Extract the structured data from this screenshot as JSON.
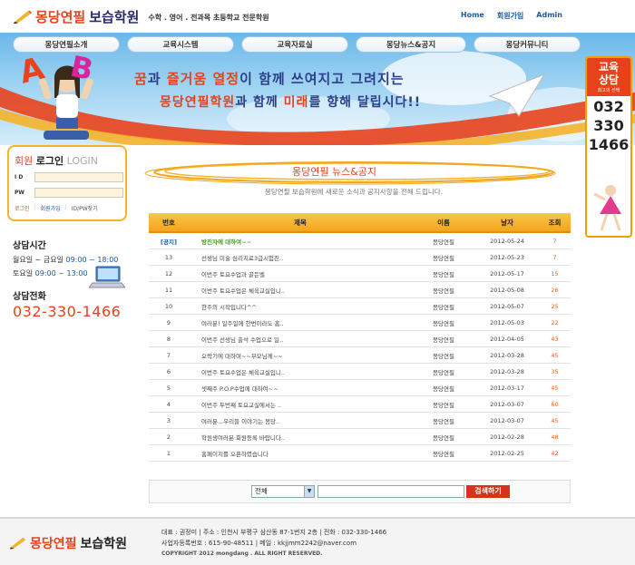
{
  "header": {
    "logo_red": "몽당연필",
    "logo_dark": "보습학원",
    "subtitle": "수학 . 영어 . 전과목 초등학교 전문학원",
    "links": [
      "Home",
      "회원가입",
      "Admin"
    ]
  },
  "nav": {
    "items": [
      "몽당연필소개",
      "교육시스템",
      "교육자료실",
      "몽당뉴스&공지",
      "몽당커뮤니티"
    ]
  },
  "banner": {
    "slogan1_a": "꿈",
    "slogan1_b": "과 ",
    "slogan1_c": "즐거움 열정",
    "slogan1_d": "이 함께 쓰여지고 그려지는",
    "slogan2_a": "몽당연필학원",
    "slogan2_b": "과 함께 ",
    "slogan2_c": "미래",
    "slogan2_d": "를 향해 달립시다!!",
    "letter_a": "A",
    "letter_b": "B"
  },
  "consult": {
    "title1": "교육",
    "title2": "상담",
    "caption": "최고의 선택",
    "num1": "032",
    "num2": "330",
    "num3": "1466"
  },
  "login": {
    "title_a": "회원",
    "title_b": "로그인",
    "title_c": "LOGIN",
    "id_label": "I D",
    "pw_label": "PW",
    "link_login": "로그인",
    "link_join": "회원가입",
    "link_find": "ID/PW찾기"
  },
  "hours": {
    "title": "상담시간",
    "weekday_label": "월요일 ~ 금요일",
    "weekday_time": "09:00 ~ 18:00",
    "sat_label": "토요일",
    "sat_time": "09:00 ~ 13:00"
  },
  "phone": {
    "title": "상담전화",
    "number": "032-330-1466"
  },
  "board": {
    "title": "몽당연필 뉴스&공지",
    "subtitle": "몽당연필 보습학원에 새로운 소식과 공지사항을 전해 드립니다.",
    "columns": {
      "no": "번호",
      "subject": "제목",
      "name": "이름",
      "date": "날자",
      "hits": "조회"
    },
    "rows": [
      {
        "no": "[공지]",
        "subject": "방진자에 대하여~~",
        "name": "몽당연필",
        "date": "2012-05-24",
        "hits": "7"
      },
      {
        "no": "13",
        "subject": "선생님 미술 심리치료3급시험친..",
        "name": "몽당연필",
        "date": "2012-05-23",
        "hits": "7"
      },
      {
        "no": "12",
        "subject": "이번주 토요수업과 골든벨",
        "name": "몽당연필",
        "date": "2012-05-17",
        "hits": "15"
      },
      {
        "no": "11",
        "subject": "이번주 토요수업은 체육교실입니..",
        "name": "몽당연필",
        "date": "2012-05-08",
        "hits": "26"
      },
      {
        "no": "10",
        "subject": "한주의 시작입니다^^",
        "name": "몽당연필",
        "date": "2012-05-07",
        "hits": "25"
      },
      {
        "no": "9",
        "subject": "여러분! 일주일에 한번이라도 홈..",
        "name": "몽당연필",
        "date": "2012-05-03",
        "hits": "22"
      },
      {
        "no": "8",
        "subject": "이번주 선생님 출석 수업으로 일..",
        "name": "몽당연필",
        "date": "2012-04-05",
        "hits": "43"
      },
      {
        "no": "7",
        "subject": "오락기에 대하여~~부모님께~~",
        "name": "몽당연필",
        "date": "2012-03-28",
        "hits": "45"
      },
      {
        "no": "6",
        "subject": "이번주 토요수업은 체육교실입니..",
        "name": "몽당연필",
        "date": "2012-03-28",
        "hits": "35"
      },
      {
        "no": "5",
        "subject": "셋째주 P.O.P수업에 대하여~~",
        "name": "몽당연필",
        "date": "2012-03-17",
        "hits": "45"
      },
      {
        "no": "4",
        "subject": "이번주 두번째 토요교실에서는 ..",
        "name": "몽당연필",
        "date": "2012-03-07",
        "hits": "60"
      },
      {
        "no": "3",
        "subject": "여러분...우리들 이야기는 몽당..",
        "name": "몽당연필",
        "date": "2012-03-07",
        "hits": "45"
      },
      {
        "no": "2",
        "subject": "학원생여러분 회원등록 바랍니다..",
        "name": "몽당연필",
        "date": "2012-02-28",
        "hits": "48"
      },
      {
        "no": "1",
        "subject": "홈페이지를 오픈하였습니다",
        "name": "몽당연필",
        "date": "2012-02-25",
        "hits": "42"
      }
    ]
  },
  "search": {
    "select_value": "전체",
    "button": "검색하기"
  },
  "footer": {
    "logo_red": "몽당연필",
    "logo_dark": "보습학원",
    "line1": "대표 : 권정미   |   주소 : 인천시 부평구 삼산동 87-1번지 2층   |   전화 : 032-330-1466",
    "line2": "사업자등록번호 :  615-90-48511   |   메일 :  kkjjmm2242@naver.com",
    "copyright": "COPYRIGHT 2012 mongdang . ALL RIGHT RESERVED."
  },
  "colors": {
    "accent_red": "#e8421c",
    "accent_orange": "#f2a51b",
    "link_blue": "#1a5aa8"
  }
}
